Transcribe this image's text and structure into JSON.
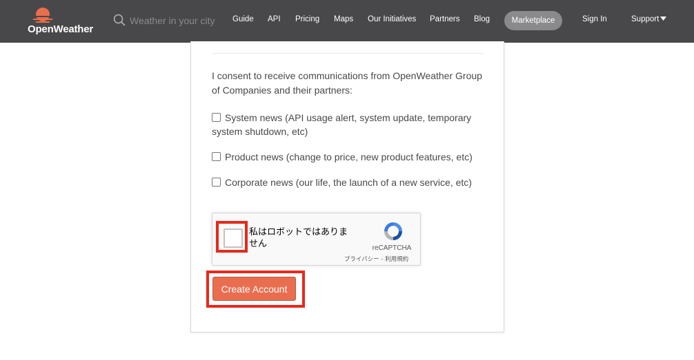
{
  "header": {
    "logo_text": "OpenWeather",
    "search_placeholder": "Weather in your city",
    "nav": [
      "Guide",
      "API",
      "Pricing",
      "Maps",
      "Our Initiatives",
      "Partners",
      "Blog"
    ],
    "marketplace": "Marketplace",
    "sign_in": "Sign In",
    "support": "Support"
  },
  "form": {
    "consent_text": "I consent to receive communications from OpenWeather Group of Companies and their partners:",
    "options": [
      {
        "label": "System news (API usage alert, system update, temporary system shutdown, etc)",
        "checked": false
      },
      {
        "label": "Product news (change to price, new product features, etc)",
        "checked": false
      },
      {
        "label": "Corporate news (our life, the launch of a new service, etc)",
        "checked": false
      }
    ],
    "recaptcha": {
      "label": "私はロボットではありません",
      "brand": "reCAPTCHA",
      "privacy": "プライバシー",
      "separator": " - ",
      "terms": "利用規約"
    },
    "submit_label": "Create Account"
  },
  "colors": {
    "header_bg": "#48484a",
    "accent": "#e96e50",
    "highlight": "#e8281c"
  }
}
